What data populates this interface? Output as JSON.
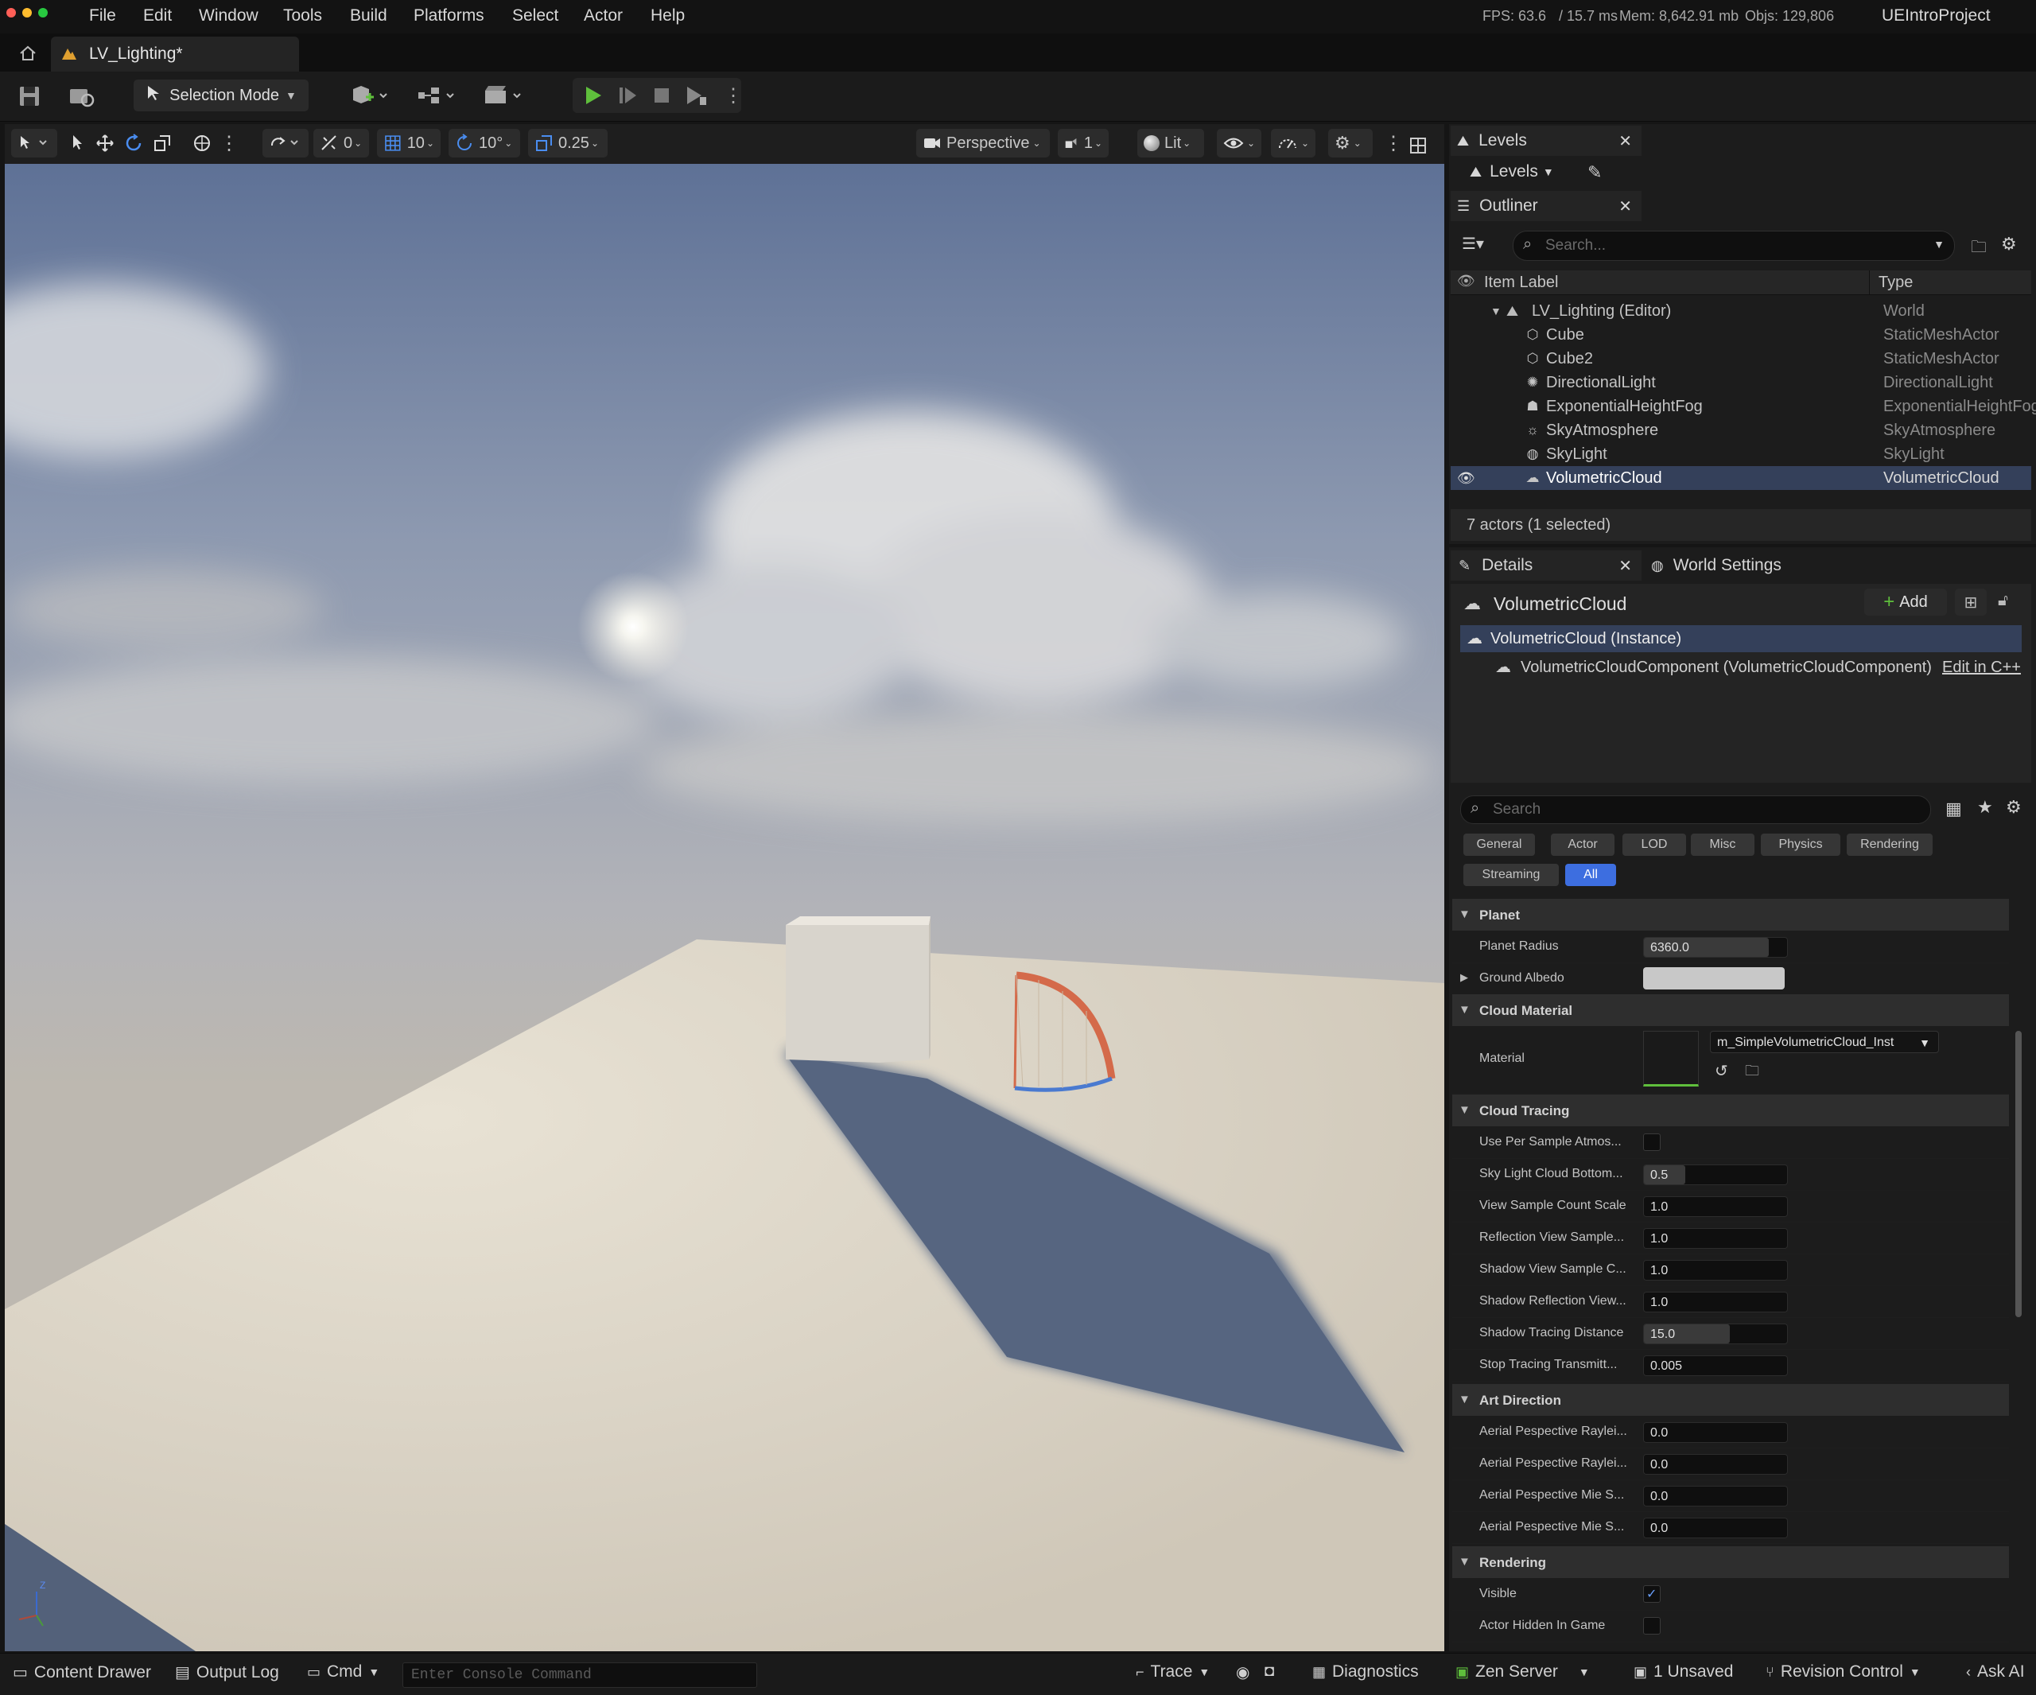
{
  "menubar": {
    "items": [
      "File",
      "Edit",
      "Window",
      "Tools",
      "Build",
      "Platforms",
      "Select",
      "Actor",
      "Help"
    ],
    "stats": {
      "fps": "FPS: 63.6",
      "ms": "/ 15.7 ms",
      "mem": "Mem: 8,642.91 mb",
      "objs": "Objs: 129,806"
    },
    "project": "UEIntroProject"
  },
  "tabs": {
    "level_tab": "LV_Lighting*"
  },
  "toolbar": {
    "selection_mode": "Selection Mode"
  },
  "viewport_toolbar": {
    "rot_snap": "0",
    "grid_snap": "10",
    "angle_snap": "10°",
    "scale_snap": "0.25",
    "perspective": "Perspective",
    "camera_speed": "1",
    "view_mode": "Lit"
  },
  "levels_panel": {
    "tab": "Levels",
    "dropdown": "Levels"
  },
  "outliner": {
    "tab": "Outliner",
    "search_placeholder": "Search...",
    "col_label": "Item Label",
    "col_type": "Type",
    "world": {
      "label": "LV_Lighting (Editor)",
      "type": "World"
    },
    "items": [
      {
        "label": "Cube",
        "type": "StaticMeshActor",
        "icon": "cube-icon"
      },
      {
        "label": "Cube2",
        "type": "StaticMeshActor",
        "icon": "cube-icon"
      },
      {
        "label": "DirectionalLight",
        "type": "DirectionalLight",
        "icon": "sun-icon"
      },
      {
        "label": "ExponentialHeightFog",
        "type": "ExponentialHeightFog",
        "icon": "fog-icon"
      },
      {
        "label": "SkyAtmosphere",
        "type": "SkyAtmosphere",
        "icon": "atmosphere-icon"
      },
      {
        "label": "SkyLight",
        "type": "SkyLight",
        "icon": "skylight-icon"
      },
      {
        "label": "VolumetricCloud",
        "type": "VolumetricCloud",
        "icon": "cloud-icon"
      }
    ],
    "footer": "7 actors (1 selected)"
  },
  "details": {
    "tab": "Details",
    "world_settings_tab": "World Settings",
    "actor_name": "VolumetricCloud",
    "add_label": "Add",
    "instance": "VolumetricCloud (Instance)",
    "component": "VolumetricCloudComponent (VolumetricCloudComponent)",
    "edit_cpp": "Edit in C++",
    "search_placeholder": "Search",
    "filters_row1": [
      "General",
      "Actor",
      "LOD",
      "Misc",
      "Physics",
      "Rendering"
    ],
    "filters_row2": [
      "Streaming",
      "All"
    ],
    "categories": {
      "planet": "Planet",
      "cloud_material": "Cloud Material",
      "cloud_tracing": "Cloud Tracing",
      "art_direction": "Art Direction",
      "rendering": "Rendering"
    },
    "props": {
      "planet_radius": {
        "label": "Planet Radius",
        "value": "6360.0",
        "fill": 0.87
      },
      "ground_albedo": {
        "label": "Ground Albedo",
        "color": "#c8c8c8"
      },
      "material": {
        "label": "Material",
        "value": "m_SimpleVolumetricCloud_Inst"
      },
      "use_per_sample": {
        "label": "Use Per Sample Atmos..."
      },
      "sky_light_cloud": {
        "label": "Sky Light Cloud Bottom...",
        "value": "0.5",
        "fill": 0.29
      },
      "view_sample": {
        "label": "View Sample Count Scale",
        "value": "1.0"
      },
      "reflection_view": {
        "label": "Reflection View Sample...",
        "value": "1.0"
      },
      "shadow_view": {
        "label": "Shadow View Sample C...",
        "value": "1.0"
      },
      "shadow_reflection": {
        "label": "Shadow Reflection View...",
        "value": "1.0"
      },
      "shadow_tracing": {
        "label": "Shadow Tracing Distance",
        "value": "15.0",
        "fill": 0.6
      },
      "stop_tracing": {
        "label": "Stop Tracing Transmitt...",
        "value": "0.005"
      },
      "aerial1": {
        "label": "Aerial Pespective Raylei...",
        "value": "0.0"
      },
      "aerial2": {
        "label": "Aerial Pespective Raylei...",
        "value": "0.0"
      },
      "aerial3": {
        "label": "Aerial Pespective Mie S...",
        "value": "0.0"
      },
      "aerial4": {
        "label": "Aerial Pespective Mie S...",
        "value": "0.0"
      },
      "visible": {
        "label": "Visible"
      },
      "actor_hidden": {
        "label": "Actor Hidden In Game"
      }
    }
  },
  "statusbar": {
    "content_drawer": "Content Drawer",
    "output_log": "Output Log",
    "cmd": "Cmd",
    "console_placeholder": "Enter Console Command",
    "trace": "Trace",
    "diagnostics": "Diagnostics",
    "zen_server": "Zen Server",
    "unsaved": "1 Unsaved",
    "revision_control": "Revision Control",
    "ask_ai": "Ask AI"
  },
  "colors": {
    "accent": "#3d6ee0",
    "selected_row": "#34405a",
    "play_green": "#5fbf3c"
  }
}
